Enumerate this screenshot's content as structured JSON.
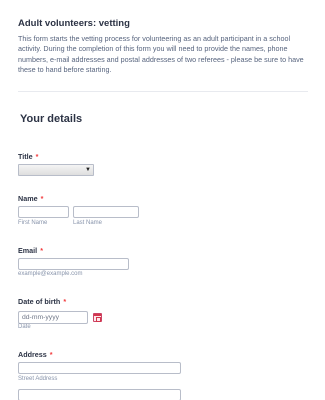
{
  "header": {
    "title": "Adult volunteers: vetting",
    "description": "This form starts the vetting process for volunteering as an adult participant in a school activity. During the completion of this form you will need to provide the names, phone numbers, e-mail addresses and postal addresses of two referees - please be sure to have these to hand before starting."
  },
  "section": {
    "title": "Your details"
  },
  "fields": {
    "title": {
      "label": "Title",
      "required_mark": "*",
      "arrow": "▼"
    },
    "name": {
      "label": "Name",
      "required_mark": "*",
      "first_sublabel": "First Name",
      "last_sublabel": "Last Name"
    },
    "email": {
      "label": "Email",
      "required_mark": "*",
      "sublabel": "example@example.com"
    },
    "dob": {
      "label": "Date of birth",
      "required_mark": "*",
      "placeholder": "dd-mm-yyyy",
      "sublabel": "Date"
    },
    "address": {
      "label": "Address",
      "required_mark": "*",
      "street_sublabel": "Street Address"
    }
  }
}
